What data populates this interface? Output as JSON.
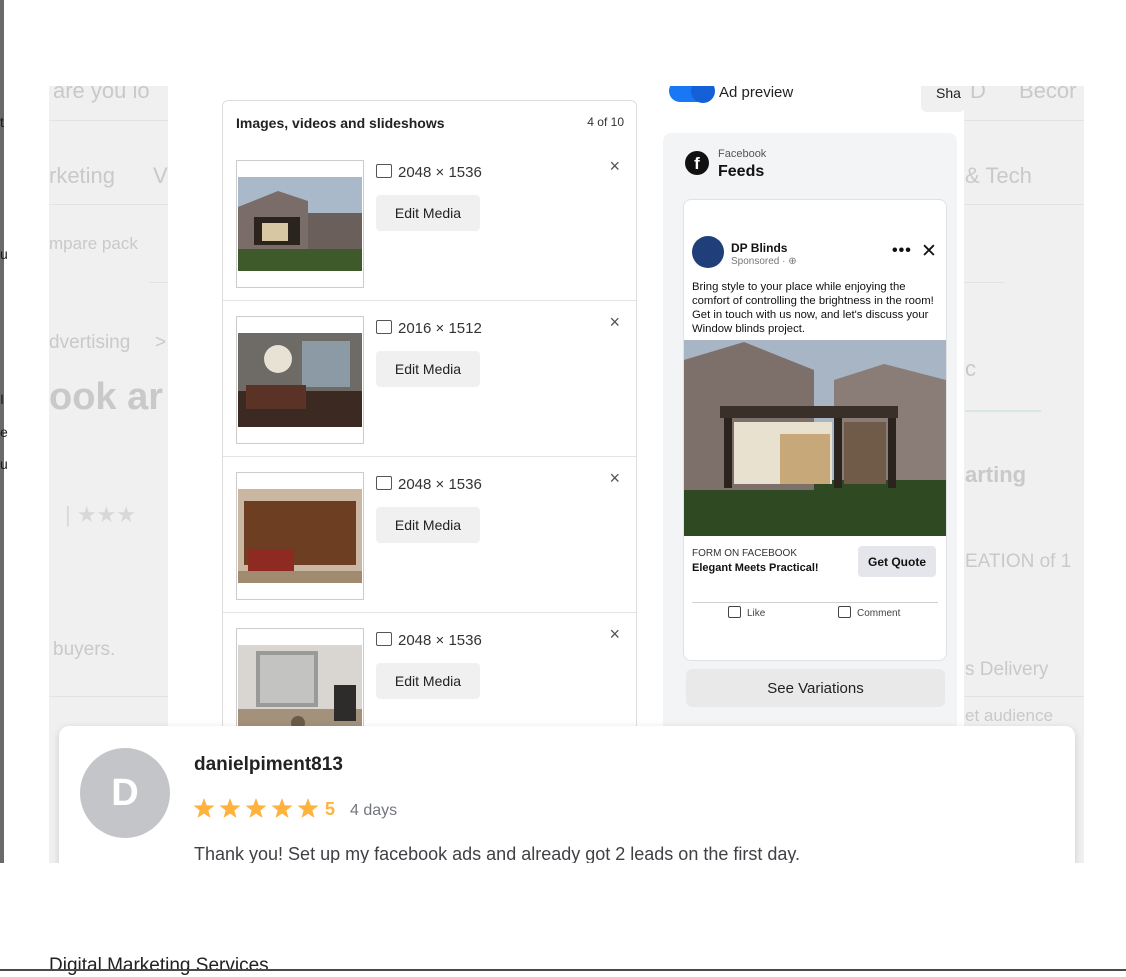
{
  "left_fragments": [
    "t",
    "u",
    "I",
    "e",
    "u"
  ],
  "background_page": {
    "search_fragment": "are you lo",
    "nav_left": "rketing",
    "nav_left2": "V",
    "nav_right_letter": "D",
    "nav_right_word": "Becor",
    "nav_tech": "& Tech",
    "compare_fragment": "mpare pack",
    "breadcrumb_fragment": "dvertising",
    "breadcrumb_arrow": ">",
    "heading_fragment": "ook ar",
    "tab_fragment": "c",
    "starting_fragment": "arting",
    "creation_fragment": "EATION of 1",
    "buyers_fragment": "buyers.",
    "delivery_fragment": "s Delivery",
    "audience_fragment": "et audience"
  },
  "ad_builder": {
    "toggle_label": "Ad preview",
    "share_label": "Sha",
    "media_title": "Images, videos and slideshows",
    "media_count": "4 of 10",
    "media": [
      {
        "dims": "2048 × 1536",
        "edit": "Edit Media"
      },
      {
        "dims": "2016 × 1512",
        "edit": "Edit Media"
      },
      {
        "dims": "2048 × 1536",
        "edit": "Edit Media"
      },
      {
        "dims": "2048 × 1536",
        "edit": "Edit Media"
      }
    ],
    "close_glyph": "×",
    "preview": {
      "platform": "Facebook",
      "placement": "Feeds",
      "page_name": "DP Blinds",
      "sponsored": "Sponsored · ⊕",
      "post_text": "Bring style to your place while enjoying the comfort of controlling the brightness in the room! Get in touch with us now, and let's discuss your Window blinds project.",
      "cta_sub": "FORM ON FACEBOOK",
      "cta_title": "Elegant Meets Practical!",
      "cta_button": "Get Quote",
      "like": "Like",
      "comment": "Comment",
      "more": "•••",
      "close": "✕",
      "see_variations": "See Variations"
    }
  },
  "review": {
    "avatar_letter": "D",
    "username": "danielpiment813",
    "rating": "5",
    "stars": 5,
    "age": "4 days",
    "text": "Thank you! Set up my facebook ads and already got 2 leads on the first day."
  },
  "footer": {
    "title": "Digital Marketing Services"
  },
  "colors": {
    "star": "#ffb33e",
    "toggle": "#1877f2"
  }
}
